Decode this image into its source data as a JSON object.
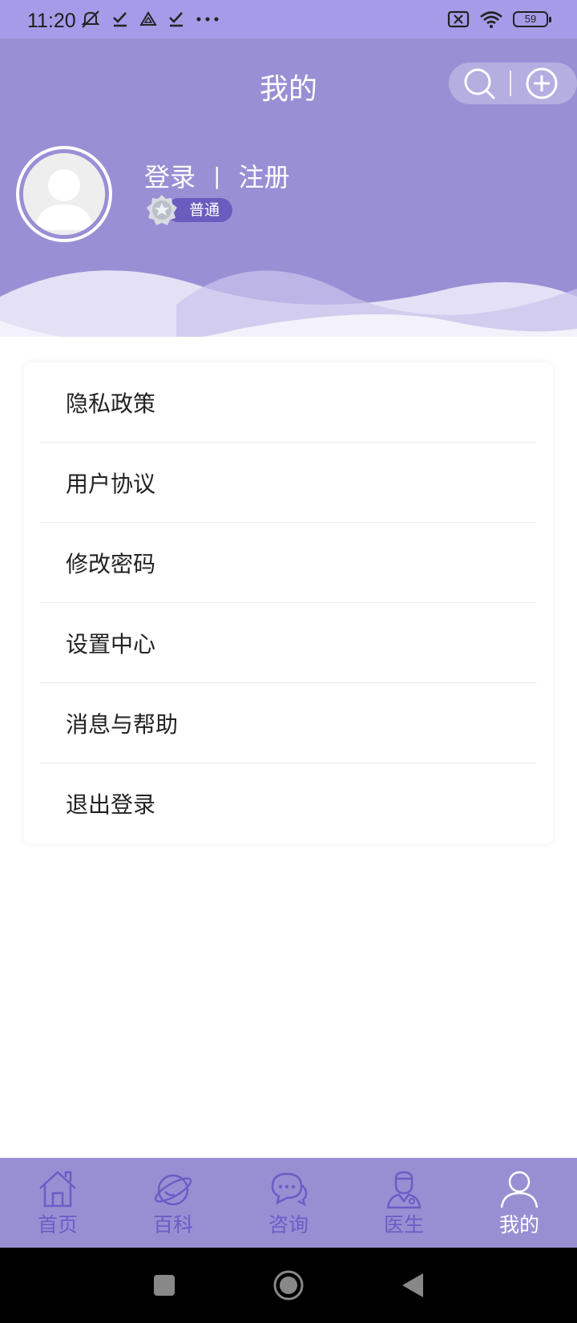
{
  "status_bar": {
    "time": "11:20",
    "battery": "59",
    "icons": [
      "mute-icon",
      "check-icon",
      "drive-icon",
      "check-icon",
      "more-dots-icon",
      "sim-off-icon",
      "wifi-icon",
      "battery-icon"
    ]
  },
  "header": {
    "title": "我的",
    "actions": [
      "search-icon",
      "add-icon"
    ],
    "bg_color": "#998fd5"
  },
  "user": {
    "login_label": "登录",
    "separator": "|",
    "register_label": "注册",
    "level_label": "普通"
  },
  "menu": {
    "items": [
      {
        "label": "隐私政策"
      },
      {
        "label": "用户协议"
      },
      {
        "label": "修改密码"
      },
      {
        "label": "设置中心"
      },
      {
        "label": "消息与帮助"
      },
      {
        "label": "退出登录"
      }
    ]
  },
  "tabbar": {
    "active_index": 4,
    "active_color": "#ffffff",
    "inactive_color": "#6b5cc6",
    "tabs": [
      {
        "label": "首页",
        "icon": "home-icon"
      },
      {
        "label": "百科",
        "icon": "planet-icon"
      },
      {
        "label": "咨询",
        "icon": "chat-icon"
      },
      {
        "label": "医生",
        "icon": "doctor-icon"
      },
      {
        "label": "我的",
        "icon": "user-icon"
      }
    ]
  },
  "system_nav": {
    "buttons": [
      "recent-apps-icon",
      "home-circle-icon",
      "back-triangle-icon"
    ]
  }
}
